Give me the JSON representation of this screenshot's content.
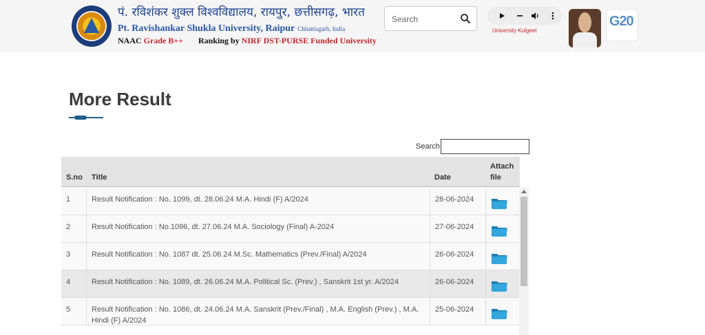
{
  "header": {
    "university_hindi": "पं. रविशंकर शुक्ल विश्वविद्यालय, रायपुर, छत्तीसगढ़, भारत",
    "university_english": "Pt. Ravishankar Shukla University, Raipur",
    "state_label": "Chhattisgarh, India",
    "naac_prefix": "NAAC",
    "naac_grade": "Grade B++",
    "ranking_prefix": "Ranking by",
    "ranking_suffix": "NIRF DST-PURSE Funded University",
    "search_placeholder": "Search",
    "kulgeet_label": "University Kulgeet",
    "g20_text": "G20"
  },
  "page": {
    "title": "More Result",
    "filter_label": "Search:"
  },
  "table": {
    "columns": [
      "S.no",
      "Title",
      "Date",
      "Attach",
      "file"
    ],
    "rows": [
      {
        "sno": "1",
        "title": "Result Notification : No. 1099, dt. 28.06.24 M.A. Hindi (F) A/2024",
        "date": "28-06-2024"
      },
      {
        "sno": "2",
        "title": "Result Notification : No.1096, dt. 27.06.24 M.A. Sociology (Final) A-2024",
        "date": "27-06-2024"
      },
      {
        "sno": "3",
        "title": "Result Notification : No. 1087 dt. 25.06.24 M.Sc. Mathematics (Prev./Final) A/2024",
        "date": "26-06-2024"
      },
      {
        "sno": "4",
        "title": "Result Notification : No. 1089, dt. 26.06.24 M.A. Political Sc. (Prev.) , Sanskrit 1st yr. A/2024",
        "date": "26-06-2024"
      },
      {
        "sno": "5",
        "title": "Result Notification : No. 1086, dt. 24.06.24 M.A. Sanskrit (Prev./Final) , M.A. English (Prev.) , M.A. Hindi (F) A/2024",
        "date": "25-06-2024"
      }
    ]
  },
  "colors": {
    "accent_blue": "#1f5f8b",
    "brand_red": "#c1272d",
    "folder_blue": "#2a9fd6"
  }
}
